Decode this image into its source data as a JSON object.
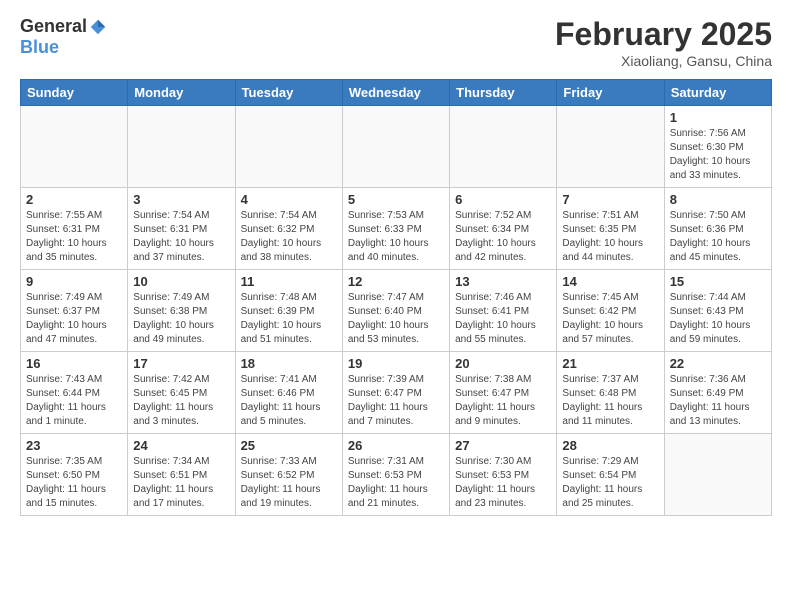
{
  "header": {
    "logo_general": "General",
    "logo_blue": "Blue",
    "title": "February 2025",
    "subtitle": "Xiaoliang, Gansu, China"
  },
  "calendar": {
    "days_of_week": [
      "Sunday",
      "Monday",
      "Tuesday",
      "Wednesday",
      "Thursday",
      "Friday",
      "Saturday"
    ],
    "weeks": [
      [
        {
          "day": "",
          "info": ""
        },
        {
          "day": "",
          "info": ""
        },
        {
          "day": "",
          "info": ""
        },
        {
          "day": "",
          "info": ""
        },
        {
          "day": "",
          "info": ""
        },
        {
          "day": "",
          "info": ""
        },
        {
          "day": "1",
          "info": "Sunrise: 7:56 AM\nSunset: 6:30 PM\nDaylight: 10 hours\nand 33 minutes."
        }
      ],
      [
        {
          "day": "2",
          "info": "Sunrise: 7:55 AM\nSunset: 6:31 PM\nDaylight: 10 hours\nand 35 minutes."
        },
        {
          "day": "3",
          "info": "Sunrise: 7:54 AM\nSunset: 6:31 PM\nDaylight: 10 hours\nand 37 minutes."
        },
        {
          "day": "4",
          "info": "Sunrise: 7:54 AM\nSunset: 6:32 PM\nDaylight: 10 hours\nand 38 minutes."
        },
        {
          "day": "5",
          "info": "Sunrise: 7:53 AM\nSunset: 6:33 PM\nDaylight: 10 hours\nand 40 minutes."
        },
        {
          "day": "6",
          "info": "Sunrise: 7:52 AM\nSunset: 6:34 PM\nDaylight: 10 hours\nand 42 minutes."
        },
        {
          "day": "7",
          "info": "Sunrise: 7:51 AM\nSunset: 6:35 PM\nDaylight: 10 hours\nand 44 minutes."
        },
        {
          "day": "8",
          "info": "Sunrise: 7:50 AM\nSunset: 6:36 PM\nDaylight: 10 hours\nand 45 minutes."
        }
      ],
      [
        {
          "day": "9",
          "info": "Sunrise: 7:49 AM\nSunset: 6:37 PM\nDaylight: 10 hours\nand 47 minutes."
        },
        {
          "day": "10",
          "info": "Sunrise: 7:49 AM\nSunset: 6:38 PM\nDaylight: 10 hours\nand 49 minutes."
        },
        {
          "day": "11",
          "info": "Sunrise: 7:48 AM\nSunset: 6:39 PM\nDaylight: 10 hours\nand 51 minutes."
        },
        {
          "day": "12",
          "info": "Sunrise: 7:47 AM\nSunset: 6:40 PM\nDaylight: 10 hours\nand 53 minutes."
        },
        {
          "day": "13",
          "info": "Sunrise: 7:46 AM\nSunset: 6:41 PM\nDaylight: 10 hours\nand 55 minutes."
        },
        {
          "day": "14",
          "info": "Sunrise: 7:45 AM\nSunset: 6:42 PM\nDaylight: 10 hours\nand 57 minutes."
        },
        {
          "day": "15",
          "info": "Sunrise: 7:44 AM\nSunset: 6:43 PM\nDaylight: 10 hours\nand 59 minutes."
        }
      ],
      [
        {
          "day": "16",
          "info": "Sunrise: 7:43 AM\nSunset: 6:44 PM\nDaylight: 11 hours\nand 1 minute."
        },
        {
          "day": "17",
          "info": "Sunrise: 7:42 AM\nSunset: 6:45 PM\nDaylight: 11 hours\nand 3 minutes."
        },
        {
          "day": "18",
          "info": "Sunrise: 7:41 AM\nSunset: 6:46 PM\nDaylight: 11 hours\nand 5 minutes."
        },
        {
          "day": "19",
          "info": "Sunrise: 7:39 AM\nSunset: 6:47 PM\nDaylight: 11 hours\nand 7 minutes."
        },
        {
          "day": "20",
          "info": "Sunrise: 7:38 AM\nSunset: 6:47 PM\nDaylight: 11 hours\nand 9 minutes."
        },
        {
          "day": "21",
          "info": "Sunrise: 7:37 AM\nSunset: 6:48 PM\nDaylight: 11 hours\nand 11 minutes."
        },
        {
          "day": "22",
          "info": "Sunrise: 7:36 AM\nSunset: 6:49 PM\nDaylight: 11 hours\nand 13 minutes."
        }
      ],
      [
        {
          "day": "23",
          "info": "Sunrise: 7:35 AM\nSunset: 6:50 PM\nDaylight: 11 hours\nand 15 minutes."
        },
        {
          "day": "24",
          "info": "Sunrise: 7:34 AM\nSunset: 6:51 PM\nDaylight: 11 hours\nand 17 minutes."
        },
        {
          "day": "25",
          "info": "Sunrise: 7:33 AM\nSunset: 6:52 PM\nDaylight: 11 hours\nand 19 minutes."
        },
        {
          "day": "26",
          "info": "Sunrise: 7:31 AM\nSunset: 6:53 PM\nDaylight: 11 hours\nand 21 minutes."
        },
        {
          "day": "27",
          "info": "Sunrise: 7:30 AM\nSunset: 6:53 PM\nDaylight: 11 hours\nand 23 minutes."
        },
        {
          "day": "28",
          "info": "Sunrise: 7:29 AM\nSunset: 6:54 PM\nDaylight: 11 hours\nand 25 minutes."
        },
        {
          "day": "",
          "info": ""
        }
      ]
    ]
  }
}
